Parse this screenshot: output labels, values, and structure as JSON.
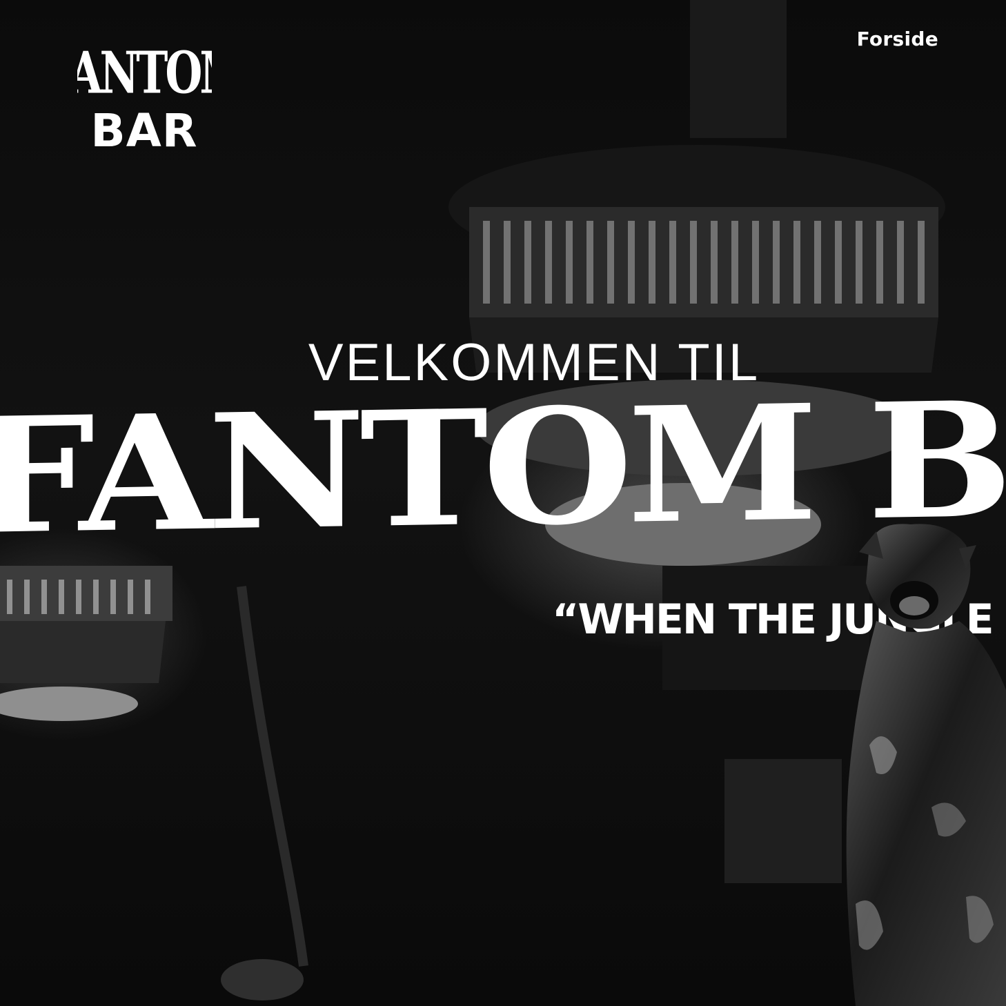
{
  "header": {
    "logo_text": "FANTOM BAR",
    "nav": {
      "forside_label": "Forside"
    }
  },
  "hero": {
    "welcome": "VELKOMMEN TIL",
    "title": "FANTOM BAR",
    "tagline": "“WHEN THE JUNGLE SLEEPS"
  },
  "icons": {
    "logo": "fantom-bar-logo",
    "panther": "panther-statue"
  },
  "colors": {
    "text": "#ffffff",
    "background": "#050505"
  }
}
